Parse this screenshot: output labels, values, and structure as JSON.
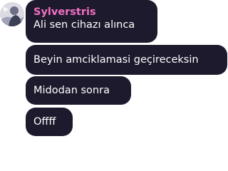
{
  "chat": {
    "sender": "Sylverstris",
    "sender_color": "#f26fc3",
    "bubble_color": "#1d1a2d",
    "avatar_icon": "user-avatar-icon",
    "messages": [
      {
        "text": "Ali sen cihazı alınca"
      },
      {
        "text": "Beyin amciklamasi geçireceksin"
      },
      {
        "text": "Midodan sonra"
      },
      {
        "text": "Offff"
      }
    ]
  }
}
